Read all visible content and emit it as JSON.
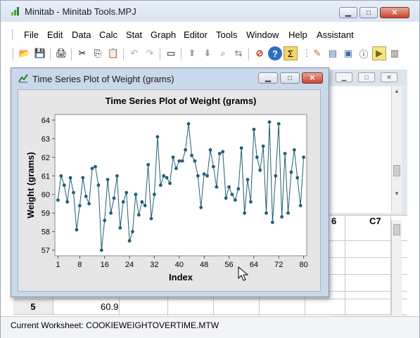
{
  "app": {
    "title": "Minitab - Minitab Tools.MPJ",
    "buttons": {
      "minimize": "▁",
      "maximize": "□",
      "close": "✕"
    }
  },
  "menu": [
    "File",
    "Edit",
    "Data",
    "Calc",
    "Stat",
    "Graph",
    "Editor",
    "Tools",
    "Window",
    "Help",
    "Assistant"
  ],
  "toolbar": {
    "icons": [
      "open-icon",
      "save-icon",
      "print-icon",
      "cut-icon",
      "copy-icon",
      "paste-icon",
      "undo-icon",
      "redo-icon",
      "session-icon",
      "up-icon",
      "down-icon",
      "find-icon",
      "replace-icon",
      "stop-icon",
      "help-icon",
      "sigma-icon",
      "toolbar-grip",
      "brush-icon",
      "stack-icon",
      "windows-icon",
      "info-icon",
      "next-icon",
      "document-icon"
    ],
    "glyphs": [
      "📂",
      "💾",
      "🖨",
      "✂",
      "⎘",
      "📋",
      "↶",
      "↷",
      "▭",
      "⬆",
      "⬇",
      "⌕",
      "⇆",
      "⊘",
      "?",
      "Σ",
      "⋮",
      "✎",
      "▤",
      "▣",
      "ⓘ",
      "▶",
      "▥"
    ]
  },
  "graph_window": {
    "title": "Time Series Plot of Weight (grams)"
  },
  "worksheet": {
    "column_headers": [
      "6",
      "C7"
    ],
    "rows": [
      {
        "num": "5",
        "value": "60.9"
      }
    ]
  },
  "status": {
    "text": "Current Worksheet: COOKIEWEIGHTOVERTIME.MTW"
  },
  "chart_data": {
    "type": "line",
    "title": "Time Series Plot of Weight (grams)",
    "xlabel": "Index",
    "ylabel": "Weight (grams)",
    "xlim": [
      0,
      81
    ],
    "ylim": [
      56.7,
      64.3
    ],
    "xticks": [
      1,
      8,
      16,
      24,
      32,
      40,
      48,
      56,
      64,
      72,
      80
    ],
    "yticks": [
      57,
      58,
      59,
      60,
      61,
      62,
      63,
      64
    ],
    "grid": false,
    "color": "#1f5f73",
    "x": [
      1,
      2,
      3,
      4,
      5,
      6,
      7,
      8,
      9,
      10,
      11,
      12,
      13,
      14,
      15,
      16,
      17,
      18,
      19,
      20,
      21,
      22,
      23,
      24,
      25,
      26,
      27,
      28,
      29,
      30,
      31,
      32,
      33,
      34,
      35,
      36,
      37,
      38,
      39,
      40,
      41,
      42,
      43,
      44,
      45,
      46,
      47,
      48,
      49,
      50,
      51,
      52,
      53,
      54,
      55,
      56,
      57,
      58,
      59,
      60,
      61,
      62,
      63,
      64,
      65,
      66,
      67,
      68,
      69,
      70,
      71,
      72,
      73,
      74,
      75,
      76,
      77,
      78,
      79,
      80
    ],
    "y": [
      59.7,
      61.0,
      60.5,
      59.6,
      60.9,
      60.1,
      58.1,
      59.4,
      60.9,
      59.9,
      59.5,
      61.4,
      61.5,
      60.5,
      57.0,
      58.6,
      60.8,
      59.0,
      59.8,
      61.0,
      58.2,
      59.6,
      60.1,
      57.5,
      58.0,
      60.0,
      58.9,
      59.6,
      59.4,
      61.6,
      58.7,
      60.0,
      63.1,
      60.5,
      61.0,
      60.9,
      60.6,
      62.0,
      61.4,
      61.8,
      61.8,
      62.4,
      63.8,
      62.1,
      61.8,
      61.0,
      59.3,
      61.1,
      61.0,
      62.4,
      61.5,
      60.4,
      62.2,
      62.3,
      59.8,
      60.4,
      60.0,
      59.7,
      60.3,
      62.5,
      59.0,
      60.8,
      59.6,
      63.5,
      62.0,
      61.3,
      62.6,
      59.0,
      63.9,
      58.5,
      61.0,
      63.8,
      58.8,
      62.2,
      59.0,
      61.2,
      62.4,
      60.9,
      59.4,
      62.0
    ]
  }
}
